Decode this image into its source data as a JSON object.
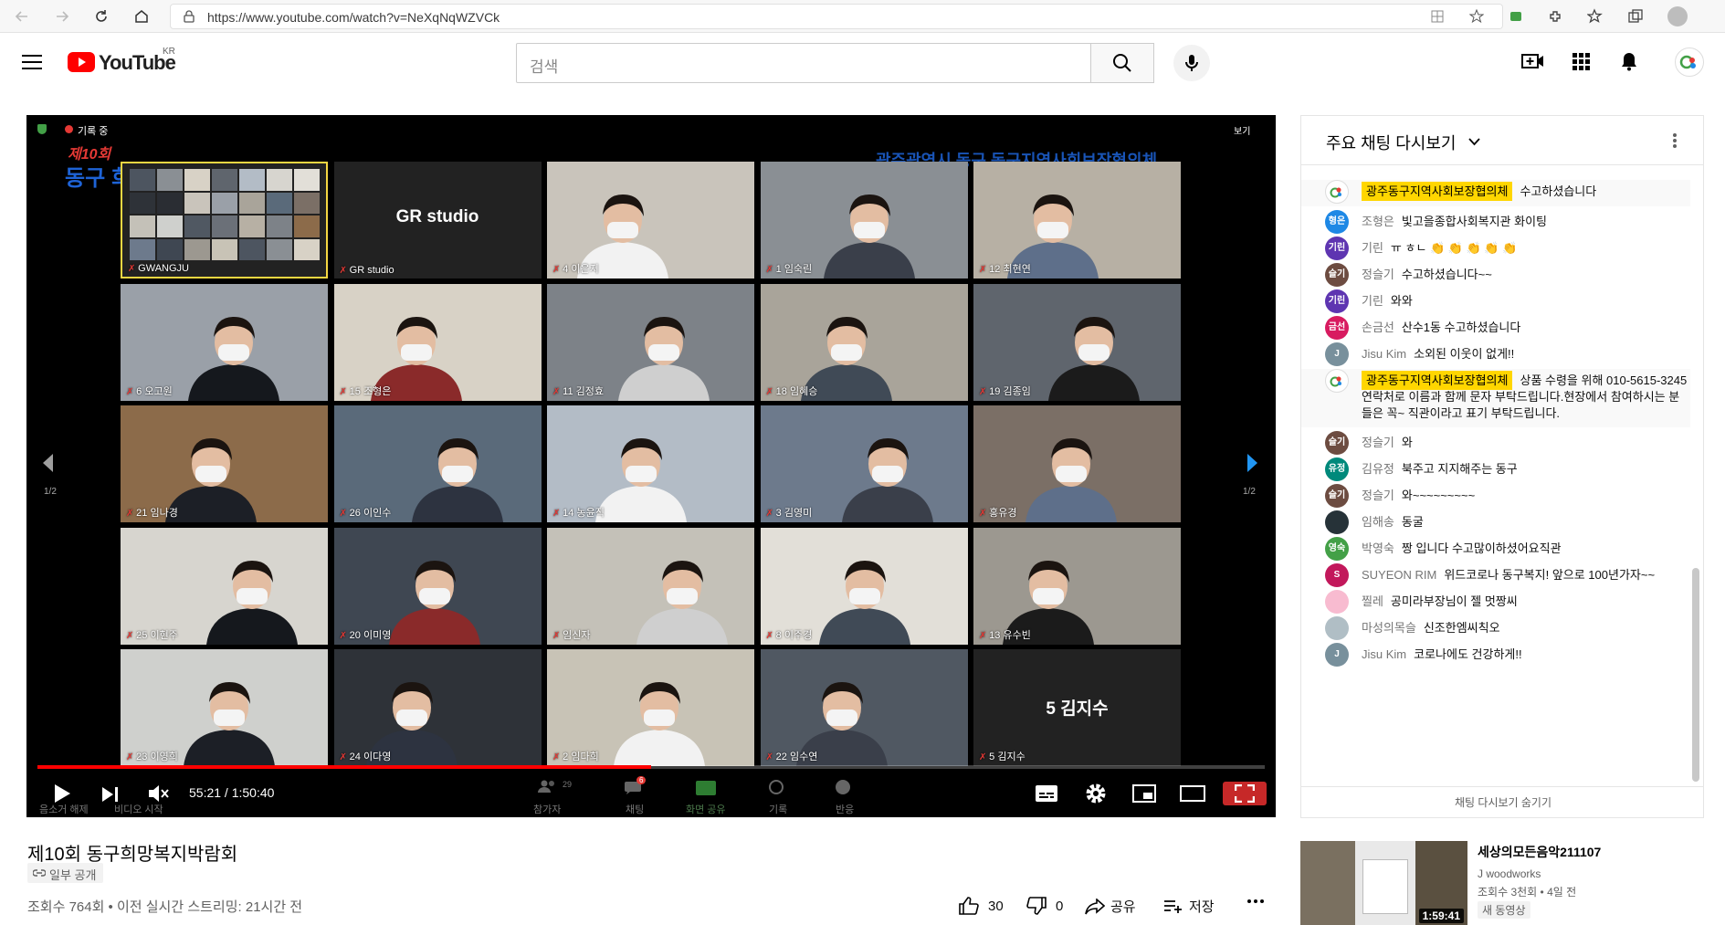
{
  "browser": {
    "url": "https://www.youtube.com/watch?v=NeXqNqWZVCk"
  },
  "header": {
    "logo_text": "YouTube",
    "region": "KR",
    "search_placeholder": "검색"
  },
  "player": {
    "top_left_status": "기록 중",
    "top_right_label": "보기",
    "event_badge_line1": "제10회",
    "event_badge_line2": "동구 희망복지박람회",
    "host_banner": "광주광역시 동구   동구지역사회보장협의체",
    "page_left": "1/2",
    "page_right": "1/2",
    "time_current": "55:21",
    "time_total": "1:50:40",
    "progress_fraction": 0.5,
    "tiles": [
      {
        "name": "GWANGJU",
        "kind": "gallery"
      },
      {
        "name": "GR studio",
        "kind": "text",
        "label": "GR studio"
      },
      {
        "name": "4 이은지"
      },
      {
        "name": "1 임숙린"
      },
      {
        "name": "12 최현연"
      },
      {
        "name": "6 오고원"
      },
      {
        "name": "15 조형은"
      },
      {
        "name": "11 김정효"
      },
      {
        "name": "18 임혜승"
      },
      {
        "name": "19 김종임"
      },
      {
        "name": "21 임나경"
      },
      {
        "name": "26 이인수"
      },
      {
        "name": "14 농윤직"
      },
      {
        "name": "3 김영미"
      },
      {
        "name": "홍유경"
      },
      {
        "name": "25 이현주"
      },
      {
        "name": "20 이미영"
      },
      {
        "name": "임신자"
      },
      {
        "name": "8 이주경"
      },
      {
        "name": "13 유수빈"
      },
      {
        "name": "23 이영희"
      },
      {
        "name": "24 이다영"
      },
      {
        "name": "2 임다희"
      },
      {
        "name": "22 임수연"
      },
      {
        "name": "5 김지수",
        "kind": "text",
        "label": "5 김지수"
      }
    ],
    "zoom_toolbar": {
      "unmute": "음소거 해제",
      "video_start": "비디오 시작",
      "participants": "참가자",
      "participants_count": "29",
      "chat": "채팅",
      "chat_badge": "6",
      "share": "화면 공유",
      "record": "기록",
      "reactions": "반응"
    }
  },
  "chat": {
    "title": "주요 채팅 다시보기",
    "hide_label": "채팅 다시보기 숨기기",
    "messages": [
      {
        "author": "광주동구지역사회보장협의체",
        "text": "수고하셨습니다",
        "moderator": true,
        "avatar": "",
        "color": "#ffffff"
      },
      {
        "author": "조형은",
        "text": "빛고을종합사회복지관 화이팅",
        "avatar": "형은",
        "color": "#1e88e5"
      },
      {
        "author": "기린",
        "text": "ㅠ ㅎㄴ 👏 👏 👏 👏 👏",
        "avatar": "기린",
        "color": "#5e35b1"
      },
      {
        "author": "정슬기",
        "text": "수고하셨습니다~~",
        "avatar": "슬기",
        "color": "#6d4c41"
      },
      {
        "author": "기린",
        "text": "와와",
        "avatar": "기린",
        "color": "#5e35b1"
      },
      {
        "author": "손금선",
        "text": "산수1동 수고하셨습니다",
        "avatar": "금선",
        "color": "#d81b60"
      },
      {
        "author": "Jisu Kim",
        "text": "소외된 이웃이 없게!!",
        "avatar": "J",
        "color": "#78909c"
      },
      {
        "author": "광주동구지역사회보장협의체",
        "text": "상품 수령을 위해 010-5615-3245 연락처로 이름과 함께 문자 부탁드립니다.현장에서 참여하시는 분들은 꼭~ 직관이라고 표기 부탁드립니다.",
        "moderator": true,
        "avatar": "",
        "color": "#ffffff"
      },
      {
        "author": "정슬기",
        "text": "와",
        "avatar": "슬기",
        "color": "#6d4c41"
      },
      {
        "author": "김유정",
        "text": "북주고 지지해주는 동구",
        "avatar": "유정",
        "color": "#00897b"
      },
      {
        "author": "정슬기",
        "text": "와~~~~~~~~~",
        "avatar": "슬기",
        "color": "#6d4c41"
      },
      {
        "author": "임해송",
        "text": "동굴",
        "avatar": "",
        "color": "#263238"
      },
      {
        "author": "박영숙",
        "text": "짱 입니다 수고많이하셨어요직관",
        "avatar": "영숙",
        "color": "#43a047"
      },
      {
        "author": "SUYEON RIM",
        "text": "위드코로나 동구복지! 앞으로 100년가자~~",
        "avatar": "S",
        "color": "#c2185b"
      },
      {
        "author": "찔레",
        "text": "공미라부장님이 젤 멋짱씨",
        "avatar": "",
        "color": "#f8bbd0"
      },
      {
        "author": "마성의목슬",
        "text": "신조한엠씨칙오",
        "avatar": "",
        "color": "#b0bec5"
      },
      {
        "author": "Jisu Kim",
        "text": "코로나에도 건강하게!!",
        "avatar": "J",
        "color": "#78909c"
      }
    ]
  },
  "video": {
    "title": "제10회 동구희망복지박람회",
    "visibility": "일부 공개",
    "stats": "조회수 764회 • 이전 실시간 스트리밍: 21시간 전",
    "likes": "30",
    "dislikes": "0",
    "share": "공유",
    "save": "저장"
  },
  "recommendation": {
    "title": "세상의모든음악211107",
    "channel": "J woodworks",
    "meta": "조회수 3천회 • 4일 전",
    "badge": "새 동영상",
    "duration": "1:59:41"
  }
}
